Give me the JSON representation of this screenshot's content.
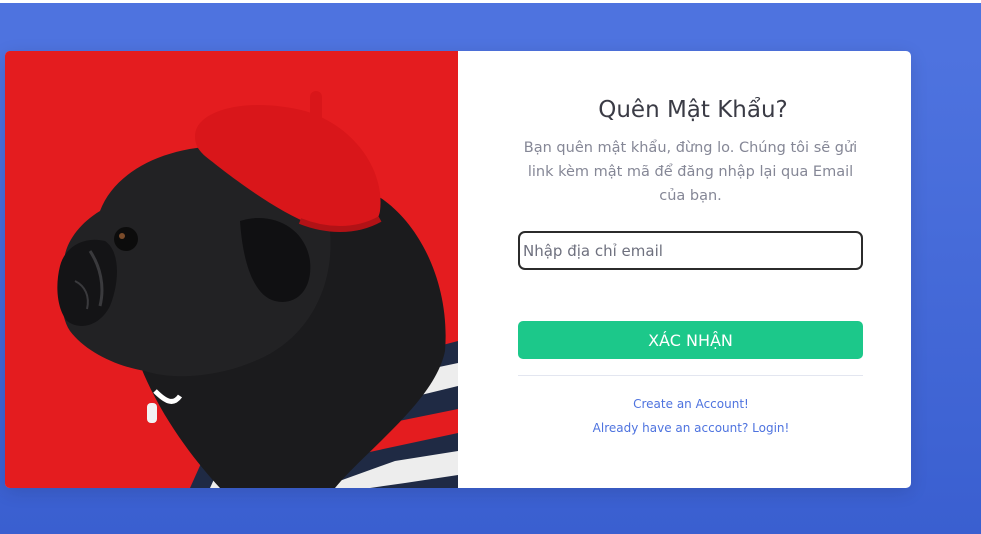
{
  "forgot_password": {
    "title": "Quên Mật Khẩu?",
    "description": "Bạn quên mật khẩu, đừng lo. Chúng tôi sẽ gửi link kèm mật mã để đăng nhập lại qua Email của bạn.",
    "email_placeholder": "Nhập địa chỉ email",
    "email_value": "",
    "submit_label": "XÁC NHẬN",
    "create_account_link": "Create an Account!",
    "login_link": "Already have an account? Login!"
  },
  "colors": {
    "background": "#4e73df",
    "button": "#1cc88a",
    "link": "#4e73df",
    "photo_background": "#e8171b"
  }
}
